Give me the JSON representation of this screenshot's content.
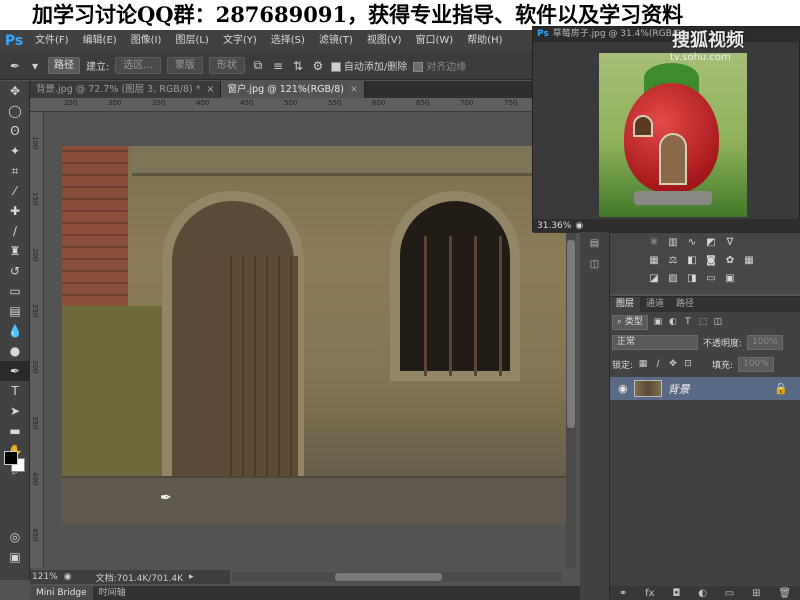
{
  "banner": {
    "text": "加学习讨论QQ群：287689091，获得专业指导、软件以及学习资料"
  },
  "menubar": {
    "logo": "Ps",
    "items": [
      "文件(F)",
      "编辑(E)",
      "图像(I)",
      "图层(L)",
      "文字(Y)",
      "选择(S)",
      "滤镜(T)",
      "视图(V)",
      "窗口(W)",
      "帮助(H)"
    ]
  },
  "options": {
    "mode": "路径",
    "build_label": "建立:",
    "selection_btn": "选区...",
    "mask_btn": "蒙版",
    "shape_btn": "形状",
    "auto_add_delete": "自动添加/删除",
    "align_edges": "对齐边缘"
  },
  "tabs": [
    {
      "label": "背景.jpg @ 72.7% (图层 3, RGB/8) *",
      "active": false
    },
    {
      "label": "窗户.jpg @ 121%(RGB/8)",
      "active": true
    }
  ],
  "ruler_top": [
    "250",
    "300",
    "350",
    "400",
    "450",
    "500",
    "550",
    "600",
    "650",
    "700",
    "750",
    "800"
  ],
  "ruler_left": [
    "100",
    "150",
    "200",
    "250",
    "300",
    "350",
    "400",
    "450"
  ],
  "status": {
    "zoom": "121%",
    "doc": "文档:701.4K/701.4K"
  },
  "bottom_tabs": [
    "Mini Bridge",
    "时间轴"
  ],
  "navigator": {
    "title": "草莓房子.jpg @ 31.4%(RGB/8)",
    "ps_icon": "Ps",
    "zoom": "31.36%",
    "watermark": "搜狐视频",
    "watermark_url": "tv.sohu.com"
  },
  "layers_panel": {
    "tabs": [
      "图层",
      "通道",
      "路径"
    ],
    "filter_kind": "类型",
    "blend_mode": "正常",
    "opacity_label": "不透明度:",
    "opacity_value": "100%",
    "lock_label": "锁定:",
    "fill_label": "填充:",
    "fill_value": "100%",
    "layer_name": "背景"
  },
  "colors": {
    "accent": "#33a7ff",
    "selected_layer": "#596a87",
    "workspace": "#535353"
  }
}
